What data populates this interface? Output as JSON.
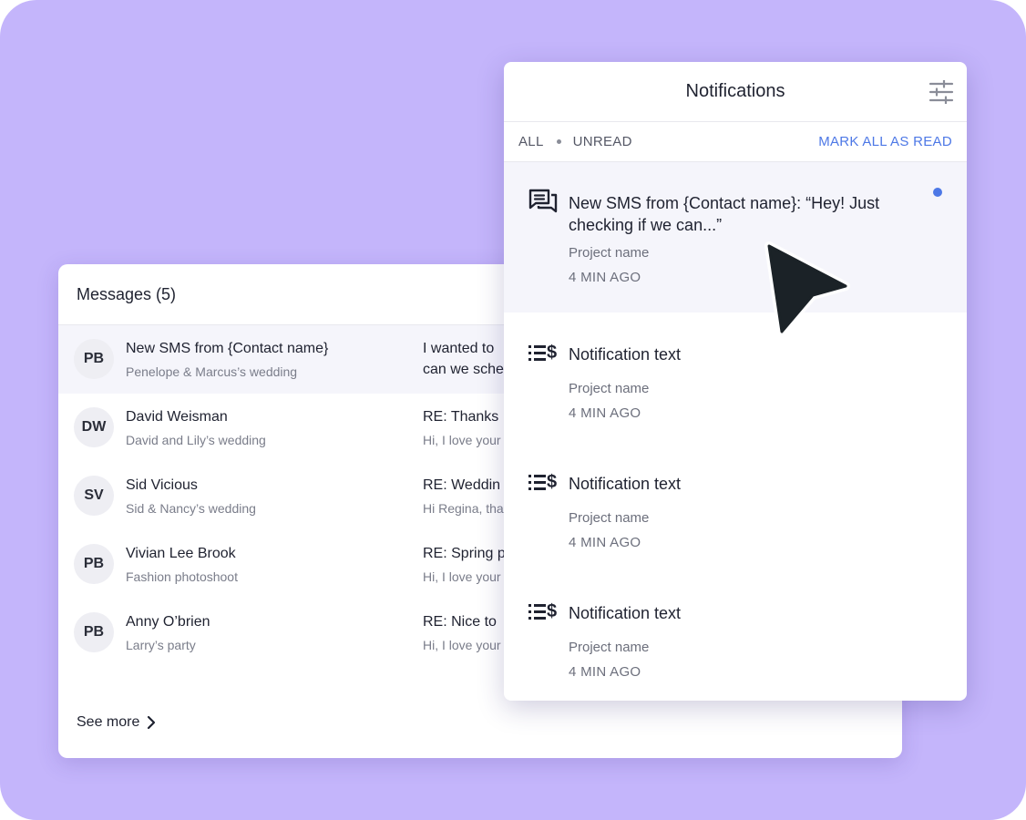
{
  "messages": {
    "title": "Messages (5)",
    "rows": [
      {
        "initials": "PB",
        "name": "New SMS from {Contact name}",
        "project": "Penelope & Marcus’s wedding",
        "subject": "I wanted to",
        "preview": "can we sche"
      },
      {
        "initials": "DW",
        "name": "David Weisman",
        "project": "David and Lily’s wedding",
        "subject": "RE: Thanks",
        "preview": "Hi, I love your"
      },
      {
        "initials": "SV",
        "name": "Sid Vicious",
        "project": "Sid & Nancy’s wedding",
        "subject": "RE: Weddin",
        "preview": "Hi Regina, tha"
      },
      {
        "initials": "PB",
        "name": "Vivian Lee Brook",
        "project": "Fashion photoshoot",
        "subject": "RE: Spring p",
        "preview": "Hi, I love your"
      },
      {
        "initials": "PB",
        "name": "Anny O’brien",
        "project": "Larry’s party",
        "subject": "RE: Nice to",
        "preview": "Hi, I love your"
      }
    ],
    "see_more": "See more"
  },
  "notifications": {
    "title": "Notifications",
    "tab_all": "ALL",
    "tab_unread": "UNREAD",
    "mark_all": "MARK ALL AS READ",
    "items": [
      {
        "icon": "chat-icon",
        "text": "New SMS from {Contact name}: “Hey! Just checking if we can...”",
        "project": "Project name",
        "time": "4 MIN AGO",
        "unread": true
      },
      {
        "icon": "list-dollar-icon",
        "text": "Notification text",
        "project": "Project name",
        "time": "4 MIN AGO",
        "unread": false
      },
      {
        "icon": "list-dollar-icon",
        "text": "Notification text",
        "project": "Project name",
        "time": "4 MIN AGO",
        "unread": false
      },
      {
        "icon": "list-dollar-icon",
        "text": "Notification text",
        "project": "Project name",
        "time": "4 MIN AGO",
        "unread": false
      }
    ]
  },
  "colors": {
    "background": "#c4b5fb",
    "accent": "#4d78e6",
    "highlight_row": "#f5f5fb"
  }
}
